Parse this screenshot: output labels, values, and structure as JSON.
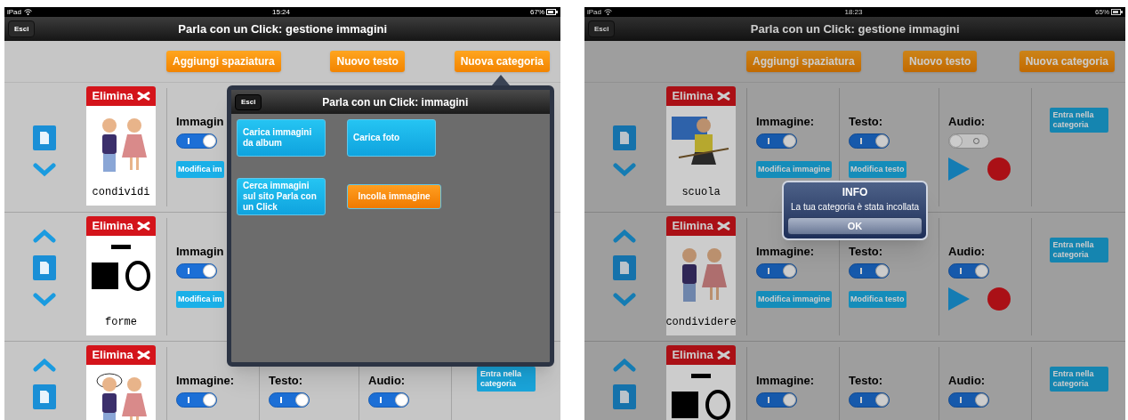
{
  "screens": [
    {
      "dimmed": false,
      "status_bar": {
        "device": "iPad",
        "time": "15:24",
        "battery": "67%"
      },
      "nav": {
        "back": "Esci",
        "title": "Parla con un Click: gestione immagini"
      },
      "actions": [
        "Aggiungi spaziatura",
        "Nuovo testo",
        "Nuova categoria"
      ],
      "rows": [
        {
          "up": false,
          "down": true,
          "delete": "Elimina",
          "picture": {
            "kind": "pair"
          },
          "word": "condividi",
          "columns": [
            {
              "label": "Immagin",
              "on": true,
              "button": "Modifica im"
            }
          ]
        },
        {
          "up": true,
          "down": true,
          "delete": "Elimina",
          "picture": {
            "kind": "shapes"
          },
          "word": "forme",
          "columns": [
            {
              "label": "Immagin",
              "on": true,
              "button": "Modifica im"
            }
          ]
        },
        {
          "up": true,
          "down": false,
          "delete": "Elimina",
          "picture": {
            "kind": "dialogue"
          },
          "columns": [
            {
              "label": "Immagine:",
              "on": true
            },
            {
              "label": "Testo:",
              "on": true
            },
            {
              "label": "Audio:",
              "on": true
            }
          ],
          "enter": "Entra nella categoria"
        }
      ],
      "popover": {
        "back": "Esci",
        "title": "Parla con un Click: immagini",
        "buttons": [
          {
            "label": "Carica immagini da album",
            "kind": "blue"
          },
          {
            "label": "Carica foto",
            "kind": "blue"
          },
          {
            "label": "Cerca immagini sul sito Parla con un Click",
            "kind": "blue"
          },
          {
            "label": "Incolla immagine",
            "kind": "orange"
          }
        ]
      }
    },
    {
      "dimmed": true,
      "status_bar": {
        "device": "iPad",
        "time": "18:23",
        "battery": "65%"
      },
      "nav": {
        "back": "Esci",
        "title": "Parla con un Click: gestione immagini"
      },
      "actions": [
        "Aggiungi spaziatura",
        "Nuovo testo",
        "Nuova categoria"
      ],
      "rows": [
        {
          "up": false,
          "down": true,
          "delete": "Elimina",
          "picture": {
            "kind": "teacher"
          },
          "word": "scuola",
          "columns": [
            {
              "label": "Immagine:",
              "on": true,
              "button": "Modifica immagine"
            },
            {
              "label": "Testo:",
              "on": true,
              "button": "Modifica testo"
            },
            {
              "label": "Audio:",
              "on": false,
              "player": true
            }
          ],
          "enter": "Entra nella categoria"
        },
        {
          "up": true,
          "down": true,
          "delete": "Elimina",
          "picture": {
            "kind": "pair"
          },
          "word": "condividere",
          "columns": [
            {
              "label": "Immagine:",
              "on": true,
              "button": "Modifica immagine"
            },
            {
              "label": "Testo:",
              "on": true,
              "button": "Modifica testo"
            },
            {
              "label": "Audio:",
              "on": true,
              "player": true
            }
          ],
          "enter": "Entra nella categoria"
        },
        {
          "up": true,
          "down": false,
          "delete": "Elimina",
          "picture": {
            "kind": "shapes"
          },
          "columns": [
            {
              "label": "Immagine:",
              "on": true
            },
            {
              "label": "Testo:",
              "on": true
            },
            {
              "label": "Audio:",
              "on": true
            }
          ],
          "enter": "Entra nella categoria"
        }
      ],
      "alert": {
        "title": "INFO",
        "message": "La tua categoria è stata incollata",
        "button": "OK"
      }
    }
  ]
}
